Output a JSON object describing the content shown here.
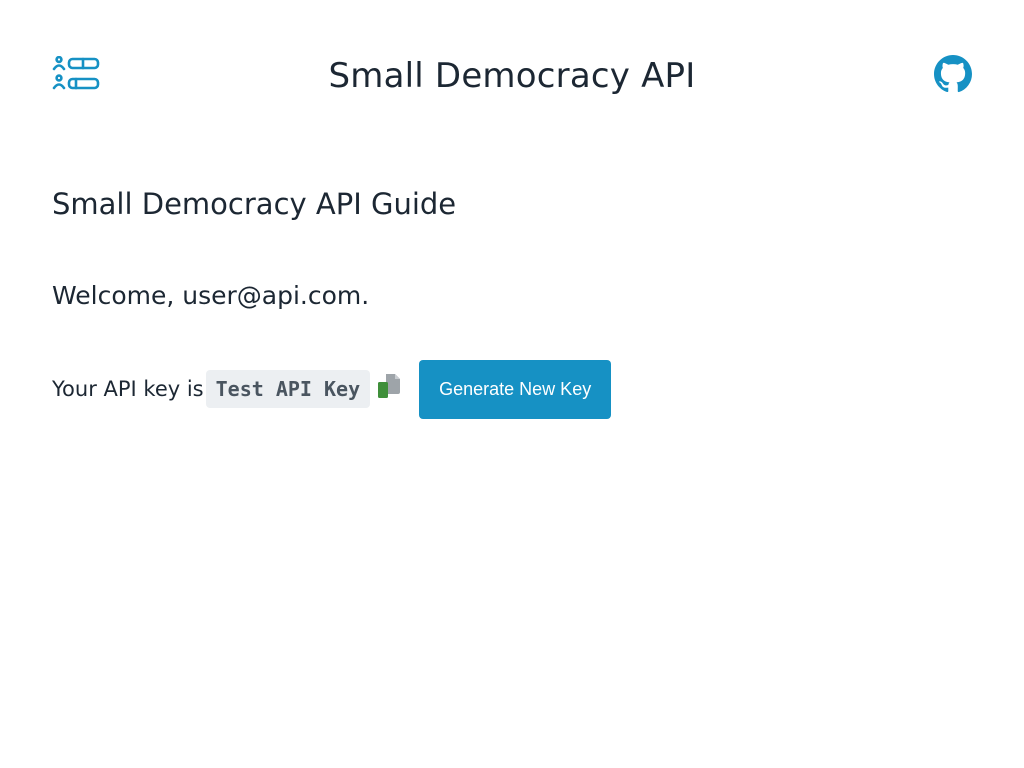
{
  "header": {
    "logo_icon": "dashboard-list-icon",
    "title": "Small Democracy API",
    "github_icon": "github-icon"
  },
  "main": {
    "guide_title": "Small Democracy API Guide",
    "welcome_text": "Welcome, user@api.com.",
    "api_key": {
      "prefix": "Your API key is",
      "value": "Test API Key",
      "copy_icon": "copy-icon",
      "generate_button_label": "Generate New Key"
    }
  },
  "colors": {
    "accent": "#1691c4",
    "text": "#1c2733",
    "code_background": "#eceff2",
    "copy_icon_green": "#3f8f3a",
    "copy_icon_gray": "#9ea4a9"
  }
}
